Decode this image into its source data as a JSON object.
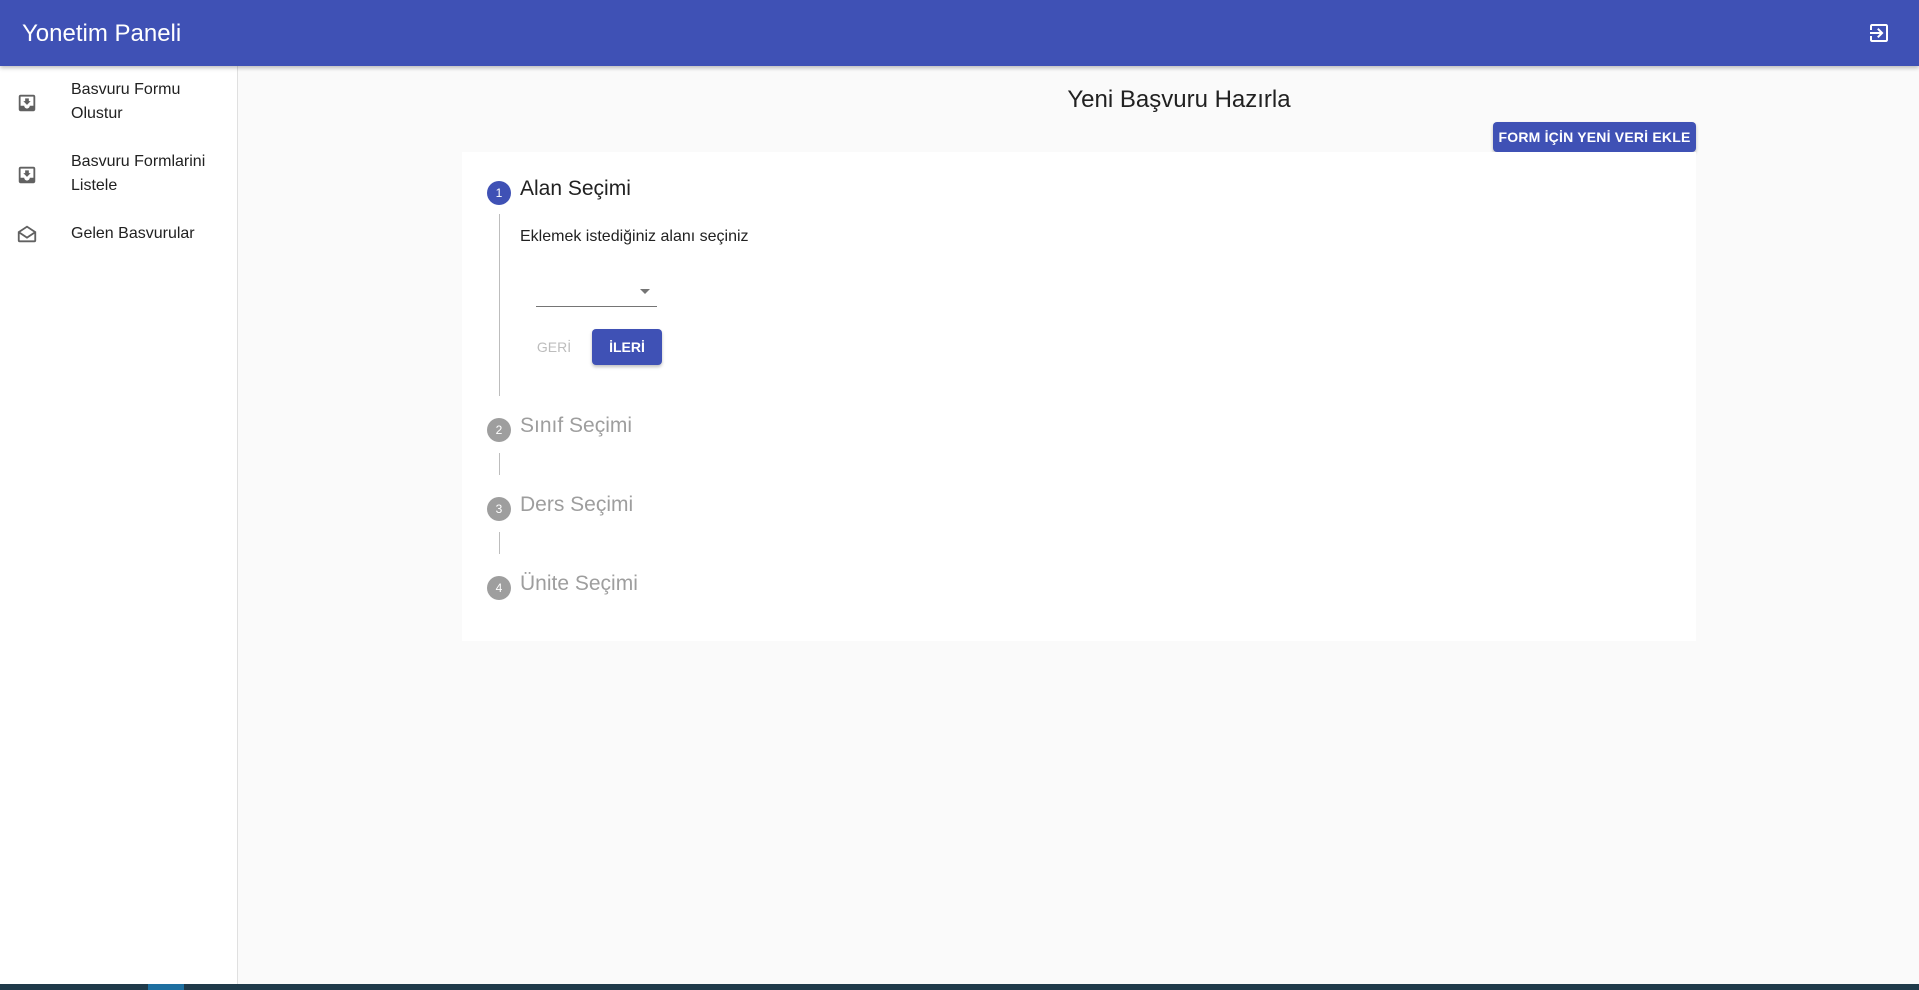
{
  "appbar": {
    "title": "Yonetim Paneli",
    "logout_icon": "exit-to-app-icon",
    "color": "#3f51b5"
  },
  "sidebar": {
    "items": [
      {
        "label": "Basvuru Formu Olustur",
        "icon": "move-to-inbox-icon"
      },
      {
        "label": "Basvuru Formlarini Listele",
        "icon": "move-to-inbox-icon"
      },
      {
        "label": "Gelen Basvurular",
        "icon": "drafts-icon"
      }
    ]
  },
  "main": {
    "title": "Yeni Başvuru Hazırla",
    "add_button_label": "FORM İÇİN YENİ VERİ EKLE"
  },
  "stepper": {
    "steps": [
      {
        "number": "1",
        "label": "Alan Seçimi",
        "active": true
      },
      {
        "number": "2",
        "label": "Sınıf Seçimi",
        "active": false
      },
      {
        "number": "3",
        "label": "Ders Seçimi",
        "active": false
      },
      {
        "number": "4",
        "label": "Ünite Seçimi",
        "active": false
      }
    ],
    "content": {
      "instruction": "Eklemek istediğiniz alanı seçiniz",
      "select_value": "",
      "back_label": "GERİ",
      "next_label": "İLERİ"
    }
  }
}
